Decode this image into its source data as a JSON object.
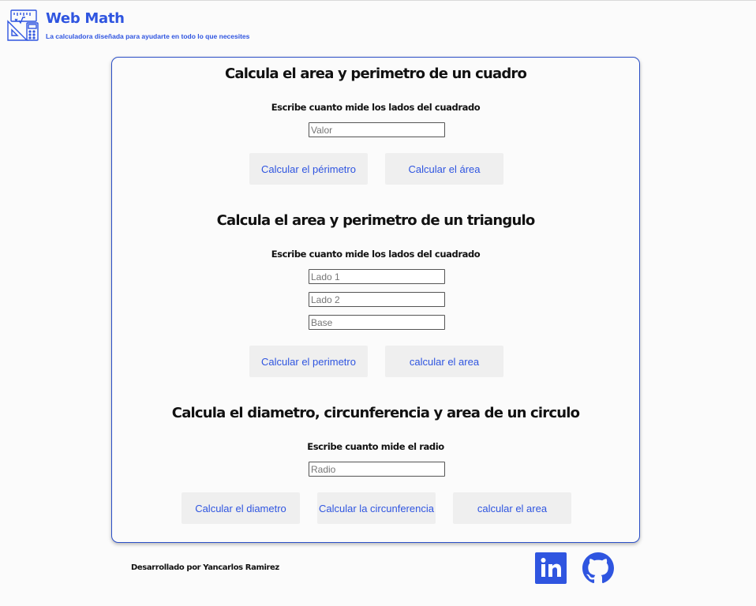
{
  "header": {
    "title": "Web Math",
    "subtitle": "La calculadora diseñada para ayudarte en todo lo que necesites",
    "logo_icon": "calculator-ruler-icon",
    "accent": "#2f55e0"
  },
  "square": {
    "title": "Calcula el area y perimetro de un cuadro",
    "label": "Escribe cuanto mide los lados del cuadrado",
    "input_placeholder": "Valor",
    "perimeter_button": "Calcular el périmetro",
    "area_button": "Calcular el área"
  },
  "triangle": {
    "title": "Calcula el area y perimetro de un triangulo",
    "label": "Escribe cuanto mide los lados del cuadrado",
    "side1_placeholder": "Lado 1",
    "side2_placeholder": "Lado 2",
    "base_placeholder": "Base",
    "perimeter_button": "Calcular el perimetro",
    "area_button": "calcular el area"
  },
  "circle": {
    "title": "Calcula el diametro, circunferencia y area de un circulo",
    "label": "Escribe cuanto mide el radio",
    "radius_placeholder": "Radio",
    "diameter_button": "Calcular el diametro",
    "circumference_button": "Calcular la circunferencia",
    "area_button": "calcular el area"
  },
  "footer": {
    "credit": "Desarrollado por Yancarlos Ramirez",
    "linkedin_icon": "linkedin-icon",
    "github_icon": "github-icon",
    "linkedin_color": "#2f55e0",
    "github_color": "#2f55e0"
  }
}
